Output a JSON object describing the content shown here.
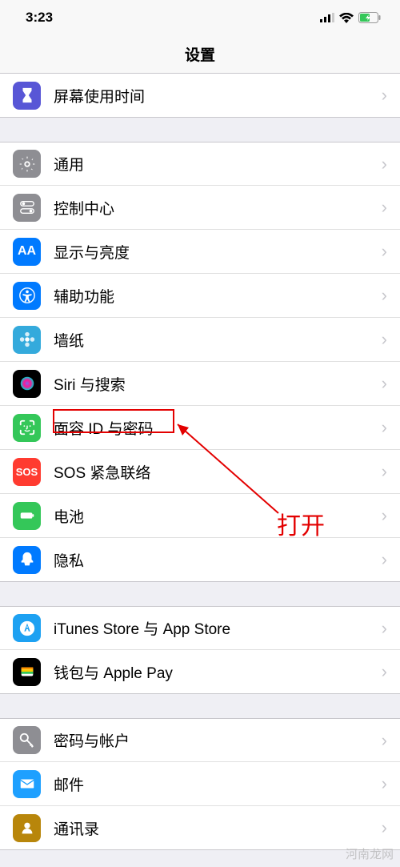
{
  "status": {
    "time": "3:23"
  },
  "nav": {
    "title": "设置"
  },
  "groups": [
    {
      "key": "g0",
      "items": [
        {
          "key": "screentime",
          "label": "屏幕使用时间",
          "icon_bg": "#5856d6",
          "icon_name": "hourglass-icon"
        }
      ]
    },
    {
      "key": "g1",
      "items": [
        {
          "key": "general",
          "label": "通用",
          "icon_bg": "#8e8e93",
          "icon_name": "gear-icon"
        },
        {
          "key": "control",
          "label": "控制中心",
          "icon_bg": "#8e8e93",
          "icon_name": "switches-icon"
        },
        {
          "key": "display",
          "label": "显示与亮度",
          "icon_bg": "#007aff",
          "icon_name": "text-size-icon"
        },
        {
          "key": "accessibility",
          "label": "辅助功能",
          "icon_bg": "#007aff",
          "icon_name": "accessibility-icon"
        },
        {
          "key": "wallpaper",
          "label": "墙纸",
          "icon_bg": "#34aadc",
          "icon_name": "flower-icon"
        },
        {
          "key": "siri",
          "label": "Siri 与搜索",
          "icon_bg": "#000",
          "icon_name": "siri-icon"
        },
        {
          "key": "faceid",
          "label": "面容 ID 与密码",
          "icon_bg": "#34c759",
          "icon_name": "faceid-icon"
        },
        {
          "key": "sos",
          "label": "SOS 紧急联络",
          "icon_bg": "#ff3b30",
          "icon_name": "sos-icon"
        },
        {
          "key": "battery",
          "label": "电池",
          "icon_bg": "#34c759",
          "icon_name": "battery-icon"
        },
        {
          "key": "privacy",
          "label": "隐私",
          "icon_bg": "#007aff",
          "icon_name": "hand-icon"
        }
      ]
    },
    {
      "key": "g2",
      "items": [
        {
          "key": "itunes",
          "label": "iTunes Store 与 App Store",
          "icon_bg": "#1da1f2",
          "icon_name": "appstore-icon"
        },
        {
          "key": "wallet",
          "label": "钱包与 Apple Pay",
          "icon_bg": "#000",
          "icon_name": "wallet-icon"
        }
      ]
    },
    {
      "key": "g3",
      "items": [
        {
          "key": "passwords",
          "label": "密码与帐户",
          "icon_bg": "#8e8e93",
          "icon_name": "key-icon"
        },
        {
          "key": "mail",
          "label": "邮件",
          "icon_bg": "#1ea0ff",
          "icon_name": "mail-icon"
        },
        {
          "key": "contacts",
          "label": "通讯录",
          "icon_bg": "#b8860b",
          "icon_name": "contacts-icon"
        }
      ]
    }
  ],
  "annotation": {
    "text": "打开"
  },
  "watermark": "河南龙网"
}
